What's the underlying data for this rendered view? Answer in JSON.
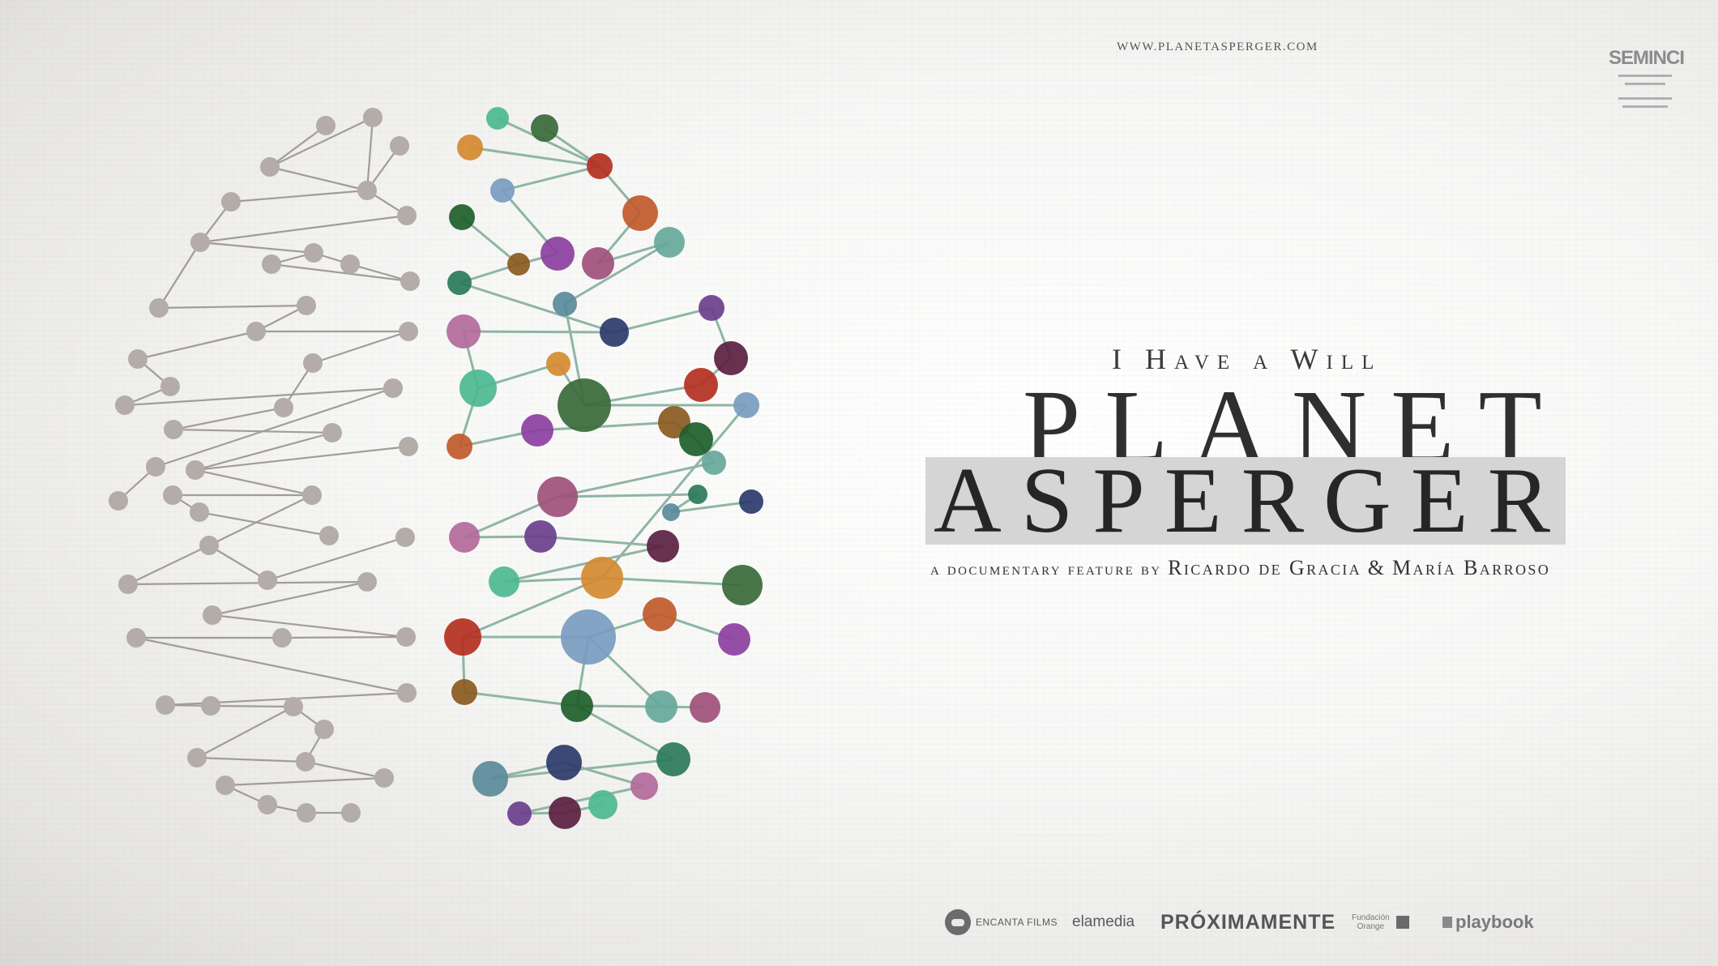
{
  "header": {
    "website": "WWW.PLANETASPERGER.COM",
    "festival_logo": {
      "name": "SEMINCI",
      "description": "festival laurel"
    }
  },
  "title": {
    "tagline_words": [
      {
        "cap": "I",
        "rest": ""
      },
      {
        "cap": "H",
        "rest": "AVE"
      },
      {
        "cap": "",
        "rest": "A"
      },
      {
        "cap": "W",
        "rest": "ILL"
      }
    ],
    "tagline": "I Have a Will",
    "line1": "PLANET",
    "line2": "ASPERGER",
    "credits_prefix": "a documentary feature by",
    "director1": "Ricardo de Gracia",
    "separator": "&",
    "director2": "María Barroso"
  },
  "footer": {
    "encanta": "ENCANTA FILMS",
    "elamedia": "elamedia",
    "coming_soon": "PRÓXIMAMENTE",
    "orange_line1": "Fundación",
    "orange_line2": "Orange",
    "playbook": "playbook"
  },
  "colors": {
    "left_hemisphere": "#b3aca8",
    "connector_left": "#a29c98",
    "connector_right": "#8fb5a4",
    "highlight_box": "#d5d5d5",
    "text": "#2f2f2f"
  },
  "illustration": {
    "description_icon": "brain-network-icon",
    "right_palette": [
      "#4db892",
      "#c05a2a",
      "#a0507a",
      "#6b3f8c",
      "#b33020",
      "#1e5e2a",
      "#2d3a6a",
      "#d48a30",
      "#8c3fa0",
      "#2a7a5a",
      "#5a2040",
      "#7a9cc0",
      "#66a89a",
      "#b36a9a",
      "#3a6a3a",
      "#8a5a20",
      "#5a8a9a"
    ]
  }
}
